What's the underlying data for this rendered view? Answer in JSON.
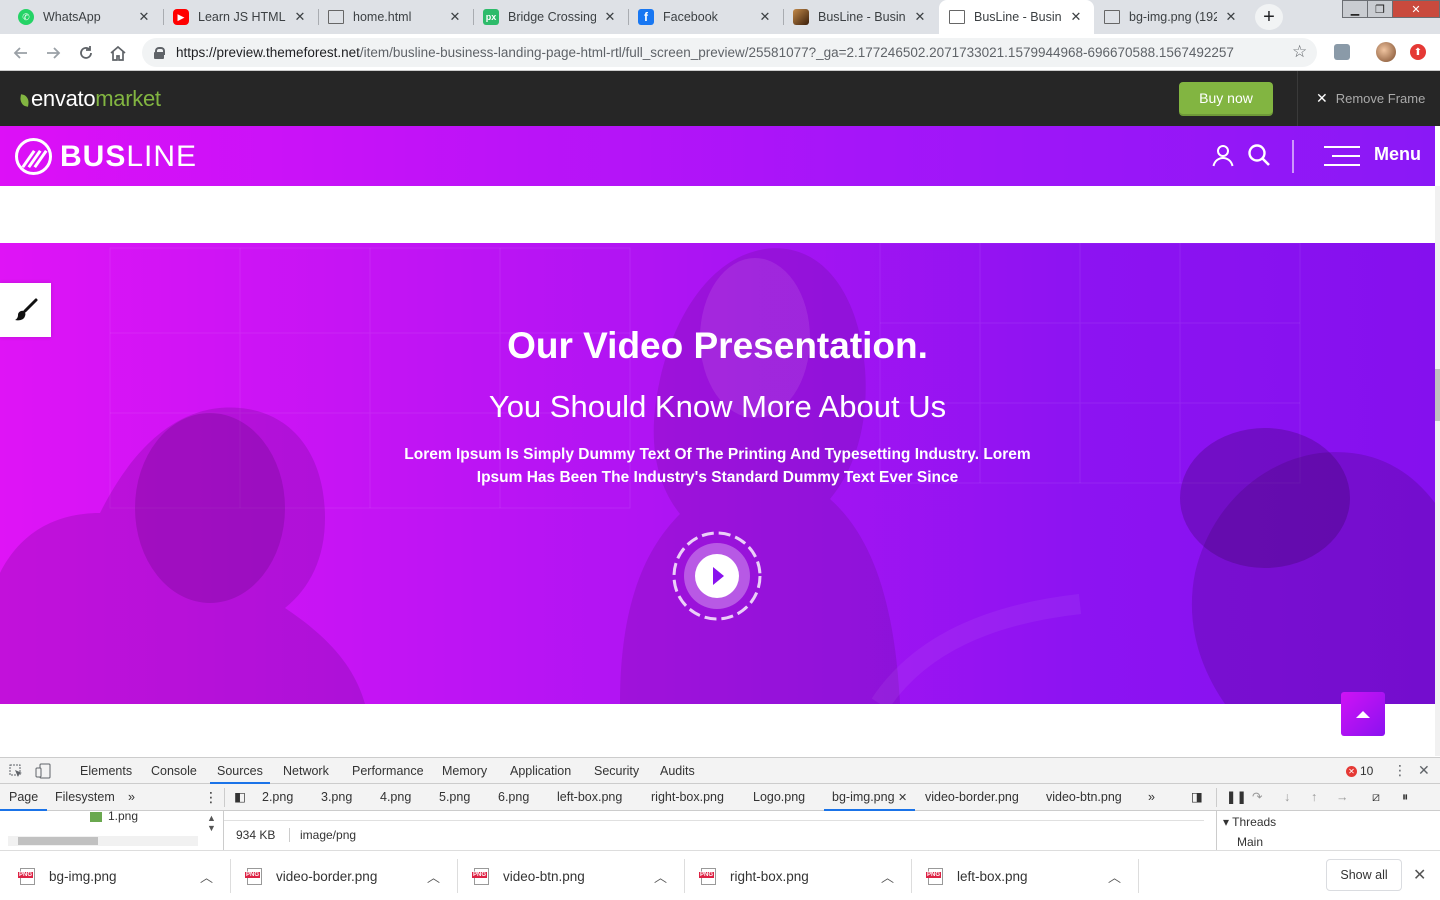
{
  "browser": {
    "tabs": [
      {
        "title": "WhatsApp",
        "favicon": "whatsapp-icon",
        "color": "#25d366"
      },
      {
        "title": "Learn JS HTML D",
        "favicon": "youtube-icon",
        "color": "#ff0000"
      },
      {
        "title": "home.html",
        "favicon": "document-icon",
        "color": "#888888"
      },
      {
        "title": "Bridge Crossing",
        "favicon": "px-icon",
        "color": "#2dbb6a"
      },
      {
        "title": "Facebook",
        "favicon": "facebook-icon",
        "color": "#1877f2"
      },
      {
        "title": "BusLine - Busine",
        "favicon": "envato-photo-icon",
        "color": "#4a2a12"
      },
      {
        "title": "BusLine - Busine",
        "favicon": "document-icon",
        "color": "#888888"
      },
      {
        "title": "bg-img.png (192",
        "favicon": "document-icon",
        "color": "#888888"
      }
    ],
    "active_tab_index": 6,
    "url_host": "https://preview.themeforest.net",
    "url_path": "/item/busline-business-landing-page-html-rtl/full_screen_preview/25581077?_ga=2.177246502.2071733021.1579944968-696670588.1567492257"
  },
  "envato": {
    "logo_main": "envato",
    "logo_sub": "market",
    "buy_label": "Buy now",
    "remove_frame_label": "Remove Frame",
    "accent": "#82b541"
  },
  "site": {
    "logo_bold": "BUS",
    "logo_thin": "LINE",
    "menu_label": "Menu",
    "gradient_start": "#dd10f7",
    "gradient_end": "#8a18f6"
  },
  "hero": {
    "title": "Our Video Presentation.",
    "subtitle": "You Should Know More About Us",
    "text": "Lorem Ipsum Is Simply Dummy Text Of The Printing And Typesetting Industry. Lorem Ipsum Has Been The Industry's Standard Dummy Text Ever Since"
  },
  "devtools": {
    "tabs": [
      "Elements",
      "Console",
      "Sources",
      "Network",
      "Performance",
      "Memory",
      "Application",
      "Security",
      "Audits"
    ],
    "active_tab": "Sources",
    "error_count": "10",
    "nav_tabs": [
      "Page",
      "Filesystem"
    ],
    "files": [
      "2.png",
      "3.png",
      "4.png",
      "5.png",
      "6.png",
      "left-box.png",
      "right-box.png",
      "Logo.png",
      "bg-img.png",
      "video-border.png",
      "video-btn.png"
    ],
    "active_file": "bg-img.png",
    "tree_item": "1.png",
    "file_size": "934 KB",
    "mime": "image/png",
    "threads_label": "Threads",
    "main_thread": "Main"
  },
  "downloads": {
    "items": [
      "bg-img.png",
      "video-border.png",
      "video-btn.png",
      "right-box.png",
      "left-box.png"
    ],
    "show_all_label": "Show all"
  }
}
